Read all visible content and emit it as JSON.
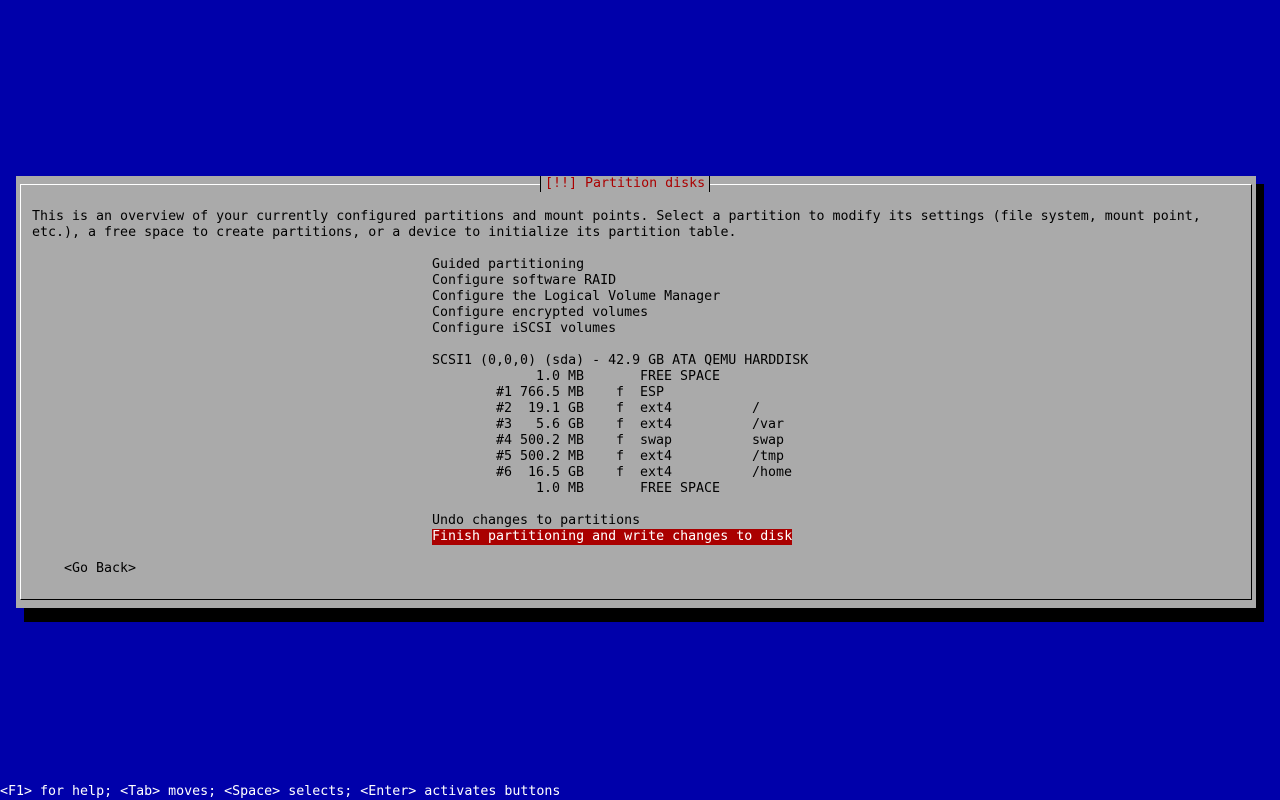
{
  "dialog": {
    "title": "[!!] Partition disks",
    "intro": "This is an overview of your currently configured partitions and mount points. Select a partition to modify its settings (file system, mount point,\netc.), a free space to create partitions, or a device to initialize its partition table.",
    "menu": {
      "guided": "Guided partitioning",
      "raid": "Configure software RAID",
      "lvm": "Configure the Logical Volume Manager",
      "encrypted": "Configure encrypted volumes",
      "iscsi": "Configure iSCSI volumes",
      "disk": "SCSI1 (0,0,0) (sda) - 42.9 GB ATA QEMU HARDDISK",
      "partitions": [
        {
          "num": "",
          "size": "1.0 MB",
          "flag": "",
          "fs": "FREE SPACE",
          "mount": ""
        },
        {
          "num": "#1",
          "size": "766.5 MB",
          "flag": "f",
          "fs": "ESP",
          "mount": ""
        },
        {
          "num": "#2",
          "size": "19.1 GB",
          "flag": "f",
          "fs": "ext4",
          "mount": "/"
        },
        {
          "num": "#3",
          "size": "5.6 GB",
          "flag": "f",
          "fs": "ext4",
          "mount": "/var"
        },
        {
          "num": "#4",
          "size": "500.2 MB",
          "flag": "f",
          "fs": "swap",
          "mount": "swap"
        },
        {
          "num": "#5",
          "size": "500.2 MB",
          "flag": "f",
          "fs": "ext4",
          "mount": "/tmp"
        },
        {
          "num": "#6",
          "size": "16.5 GB",
          "flag": "f",
          "fs": "ext4",
          "mount": "/home"
        },
        {
          "num": "",
          "size": "1.0 MB",
          "flag": "",
          "fs": "FREE SPACE",
          "mount": ""
        }
      ],
      "undo": "Undo changes to partitions",
      "finish": "Finish partitioning and write changes to disk"
    },
    "back_button": "<Go Back>"
  },
  "help_line": "<F1> for help; <Tab> moves; <Space> selects; <Enter> activates buttons",
  "colors": {
    "background": "#0000aa",
    "dialog": "#aaaaaa",
    "title": "#aa0000",
    "selection": "#aa0000"
  }
}
